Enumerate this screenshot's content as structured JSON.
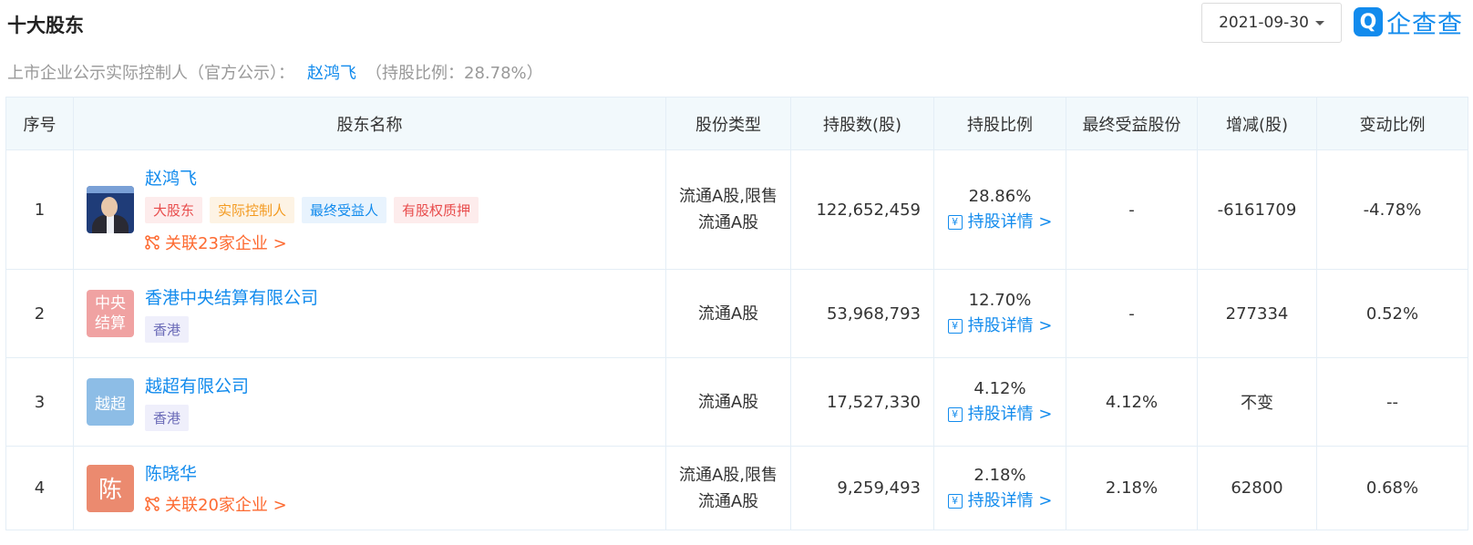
{
  "header": {
    "title": "十大股东",
    "date": "2021-09-30",
    "logo_badge": "Q",
    "logo_text": "企查查"
  },
  "controller": {
    "label": "上市企业公示实际控制人（官方公示）：",
    "name": "赵鸿飞",
    "ratio": "（持股比例：28.78%）"
  },
  "table": {
    "columns": [
      "序号",
      "股东名称",
      "股份类型",
      "持股数(股)",
      "持股比例",
      "最终受益股份",
      "增减(股)",
      "变动比例"
    ],
    "detail_label": "持股详情 >",
    "rows": [
      {
        "index": "1",
        "name": "赵鸿飞",
        "avatar": "photo",
        "tags": [
          "大股东",
          "实际控制人",
          "最终受益人",
          "有股权质押"
        ],
        "related": "关联23家企业 >",
        "type_line1": "流通A股,限售",
        "type_line2": "流通A股",
        "shares": "122,652,459",
        "ratio": "28.86%",
        "beneficial": "-",
        "change": "-6161709",
        "change_ratio": "-4.78%"
      },
      {
        "index": "2",
        "name": "香港中央结算有限公司",
        "avatar_line1": "中央",
        "avatar_line2": "结算",
        "tags": [
          "香港"
        ],
        "type_line1": "流通A股",
        "shares": "53,968,793",
        "ratio": "12.70%",
        "beneficial": "-",
        "change": "277334",
        "change_ratio": "0.52%"
      },
      {
        "index": "3",
        "name": "越超有限公司",
        "avatar_text": "越超",
        "tags": [
          "香港"
        ],
        "type_line1": "流通A股",
        "shares": "17,527,330",
        "ratio": "4.12%",
        "beneficial": "4.12%",
        "change": "不变",
        "change_ratio": "--"
      },
      {
        "index": "4",
        "name": "陈晓华",
        "avatar_text": "陈",
        "related": "关联20家企业 >",
        "type_line1": "流通A股,限售",
        "type_line2": "流通A股",
        "shares": "9,259,493",
        "ratio": "2.18%",
        "beneficial": "2.18%",
        "change": "62800",
        "change_ratio": "0.68%"
      }
    ]
  },
  "colors": {
    "accent": "#128bed",
    "related": "#fd6a31",
    "header_bg": "#f2f9fc"
  }
}
